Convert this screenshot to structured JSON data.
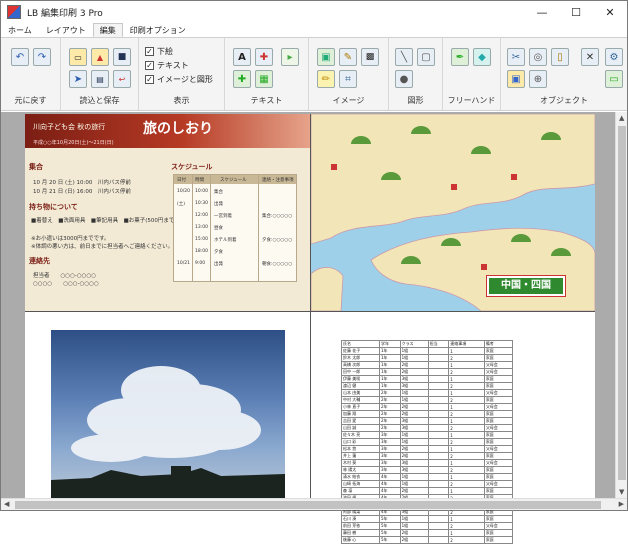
{
  "app": {
    "title": "LB 編集印刷 3 Pro"
  },
  "window_buttons": {
    "minimize": "—",
    "maximize": "☐",
    "close": "✕"
  },
  "tabs": [
    {
      "label": "ホーム"
    },
    {
      "label": "レイアウト"
    },
    {
      "label": "編集"
    },
    {
      "label": "印刷オプション"
    }
  ],
  "ribbon": {
    "undo_group": {
      "label": "元に戻す"
    },
    "loadsave_group": {
      "label": "読込と保存"
    },
    "view_group": {
      "label": "表示",
      "check_underlay": "下絵",
      "check_text": "テキスト",
      "check_image_shape": "イメージと図形"
    },
    "text_group": {
      "label": "テキスト"
    },
    "image_group": {
      "label": "イメージ"
    },
    "shape_group": {
      "label": "図形"
    },
    "freehand_group": {
      "label": "フリーハンド"
    },
    "object_group": {
      "label": "オブジェクト"
    }
  },
  "icons": {
    "undo": "↶",
    "redo": "↷",
    "open": "📂",
    "import": "📥",
    "save": "💾",
    "a": "A",
    "check": "✓"
  },
  "panel_guide": {
    "banner_sub": "川向子ども会 秋の旅行",
    "banner_title": "旅のしおり",
    "banner_date": "平成○○年10月20日(土)～21日(日)",
    "sec_schedule_head": "集合",
    "line1": "10 月 20 日 (土) 10:00　川内バス停前",
    "line2": "10 月 21 日 (日) 16:00　川内バス停前",
    "sec_items": "持ち物について",
    "items_line": "■着替え　■洗面用具　■筆記用具　■お菓子(500円まで)",
    "note1": "※お小遣いは3000円までです。",
    "note2": "※体調の悪い方は、前日までに担当者へご連絡ください。",
    "sec_contact": "連絡先",
    "contact1": "担当者　　○○○-○○○○",
    "contact2": "○○○○　　○○○-○○○○",
    "schedule_title": "スケジュール",
    "sched_headers": [
      "日付",
      "時間",
      "スケジュール",
      "連絡・注意事項"
    ],
    "sched_rows": [
      [
        "10/20",
        "10:00",
        "集合",
        ""
      ],
      [
        "(土)",
        "10:30",
        "出発",
        ""
      ],
      [
        "",
        "12:00",
        "一宮到着",
        "集合:○○○○○"
      ],
      [
        "",
        "13:00",
        "昼食",
        ""
      ],
      [
        "",
        "15:00",
        "ホテル到着",
        "夕食:○○○○○"
      ],
      [
        "",
        "18:00",
        "夕食",
        ""
      ],
      [
        "10/21",
        "9:00",
        "出発",
        "朝食:○○○○○"
      ]
    ]
  },
  "panel_map": {
    "badge": "中国・四国"
  },
  "panel_table": {
    "headers": [
      "氏名",
      "学年",
      "クラス",
      "担当",
      "連絡事項",
      "備考"
    ],
    "rows": [
      [
        "佐藤 花子",
        "1年",
        "1組",
        "",
        "1",
        "家庭"
      ],
      [
        "鈴木 太郎",
        "1年",
        "1組",
        "",
        "2",
        "家庭"
      ],
      [
        "高橋 次郎",
        "1年",
        "2組",
        "",
        "1",
        "父母会"
      ],
      [
        "田中 一郎",
        "1年",
        "2組",
        "",
        "2",
        "父母会"
      ],
      [
        "伊藤 美咲",
        "1年",
        "3組",
        "",
        "1",
        "家庭"
      ],
      [
        "渡辺 健",
        "1年",
        "3組",
        "",
        "2",
        "家庭"
      ],
      [
        "山本 由美",
        "2年",
        "1組",
        "",
        "1",
        "父母会"
      ],
      [
        "中村 大輔",
        "2年",
        "1組",
        "",
        "2",
        "家庭"
      ],
      [
        "小林 直子",
        "2年",
        "2組",
        "",
        "1",
        "父母会"
      ],
      [
        "加藤 翔",
        "2年",
        "2組",
        "",
        "2",
        "家庭"
      ],
      [
        "吉田 愛",
        "2年",
        "3組",
        "",
        "1",
        "家庭"
      ],
      [
        "山田 誠",
        "2年",
        "3組",
        "",
        "2",
        "父母会"
      ],
      [
        "佐々木 亮",
        "3年",
        "1組",
        "",
        "1",
        "家庭"
      ],
      [
        "山口 彩",
        "3年",
        "1組",
        "",
        "2",
        "家庭"
      ],
      [
        "松本 悠",
        "3年",
        "2組",
        "",
        "1",
        "父母会"
      ],
      [
        "井上 蓮",
        "3年",
        "2組",
        "",
        "2",
        "家庭"
      ],
      [
        "木村 葵",
        "3年",
        "3組",
        "",
        "1",
        "父母会"
      ],
      [
        "林 陽太",
        "3年",
        "3組",
        "",
        "2",
        "家庭"
      ],
      [
        "清水 結衣",
        "4年",
        "1組",
        "",
        "1",
        "家庭"
      ],
      [
        "山崎 拓海",
        "4年",
        "1組",
        "",
        "2",
        "父母会"
      ],
      [
        "森 凛",
        "4年",
        "2組",
        "",
        "1",
        "家庭"
      ],
      [
        "池田 颯",
        "4年",
        "2組",
        "",
        "2",
        "家庭"
      ],
      [
        "橋本 蒼",
        "4年",
        "3組",
        "",
        "1",
        "父母会"
      ],
      [
        "阿部 陽菜",
        "4年",
        "3組",
        "",
        "2",
        "家庭"
      ],
      [
        "石川 湊",
        "5年",
        "1組",
        "",
        "1",
        "家庭"
      ],
      [
        "前田 芽依",
        "5年",
        "1組",
        "",
        "2",
        "父母会"
      ],
      [
        "藤田 樹",
        "5年",
        "2組",
        "",
        "1",
        "家庭"
      ],
      [
        "後藤 心",
        "5年",
        "2組",
        "",
        "2",
        "家庭"
      ]
    ]
  }
}
